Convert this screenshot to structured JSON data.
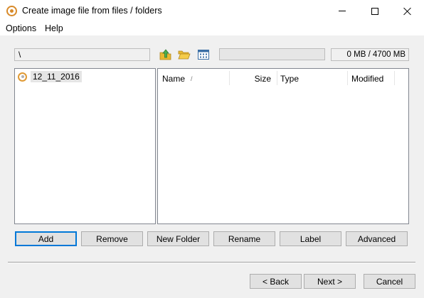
{
  "window": {
    "title": "Create image file from files / folders",
    "app_icon": "disc-icon"
  },
  "menu": {
    "items": [
      "Options",
      "Help"
    ]
  },
  "toolbar": {
    "path": "\\",
    "icons": [
      "folder-up-icon",
      "open-folder-icon",
      "grid-view-icon"
    ],
    "size_display": "0 MB / 4700 MB",
    "progress": 0
  },
  "tree": {
    "items": [
      {
        "label": "12_11_2016",
        "icon": "disc-icon"
      }
    ]
  },
  "file_list": {
    "columns": [
      {
        "label": "Name",
        "sort": "/"
      },
      {
        "label": "Size"
      },
      {
        "label": "Type"
      },
      {
        "label": "Modified"
      }
    ],
    "rows": []
  },
  "actions": {
    "add": "Add",
    "remove": "Remove",
    "new_folder": "New Folder",
    "rename": "Rename",
    "label": "Label",
    "advanced": "Advanced"
  },
  "navigation": {
    "back": "< Back",
    "next": "Next >",
    "cancel": "Cancel"
  },
  "colors": {
    "accent": "#0078d7",
    "disc": "#e09a35",
    "folder": "#e8b830",
    "arrow": "#4caf50"
  }
}
